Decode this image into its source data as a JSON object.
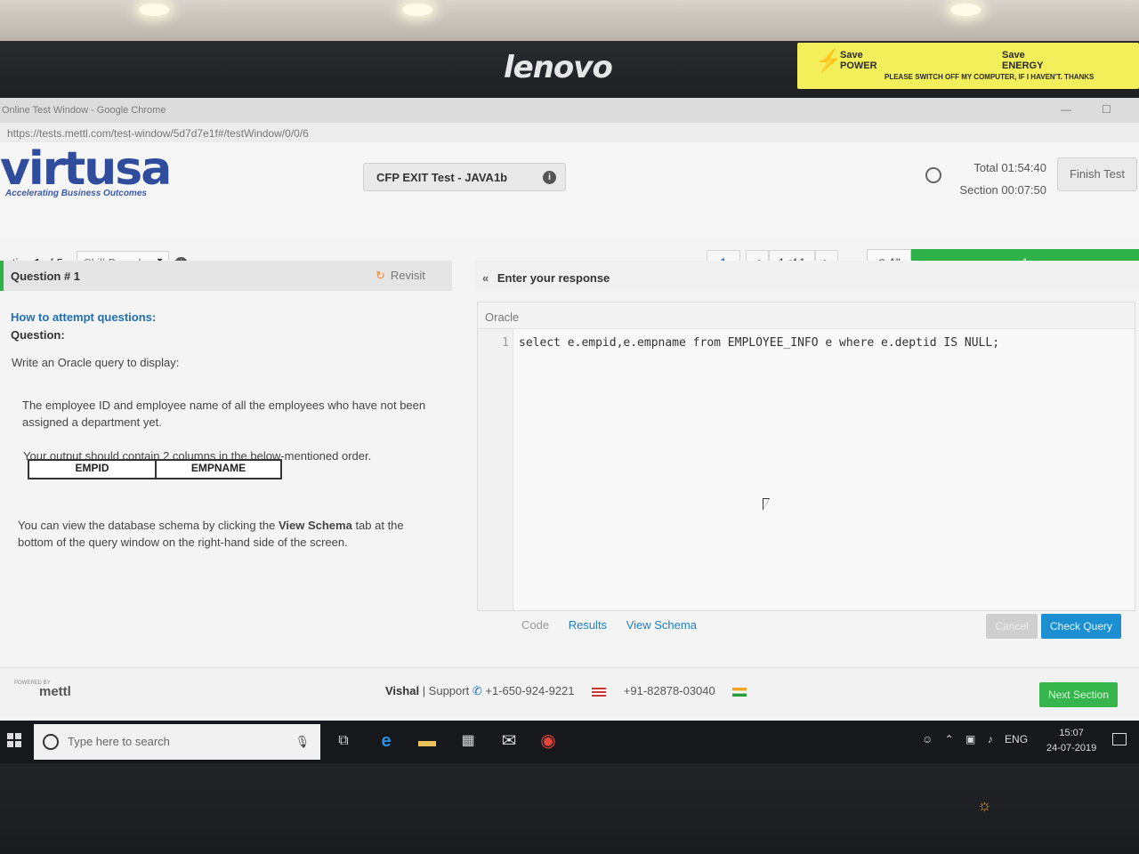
{
  "monitor": {
    "brand": "lenovo",
    "sticker": {
      "line1a": "Save",
      "line1b": "POWER",
      "line2a": "Save",
      "line2b": "ENERGY",
      "note": "PLEASE SWITCH OFF MY COMPUTER, IF I HAVEN'T. THANKS"
    }
  },
  "browser": {
    "title": "Online Test Window - Google Chrome",
    "url": "https://tests.mettl.com/test-window/5d7d7e1f#/testWindow/0/0/6"
  },
  "header": {
    "logo": "virtusa",
    "tagline": "Accelerating Business Outcomes",
    "test_title": "CFP EXIT Test - JAVA1b",
    "total_timer": "Total 01:54:40",
    "section_timer": "Section 00:07:50",
    "finish_label": "Finish Test"
  },
  "nav": {
    "section_prefix": "ection",
    "section_num": "1",
    "section_of": "of 5",
    "section_select": "Skill Based -",
    "page_current": "1",
    "prev": "<",
    "page_info": "1 of 1",
    "next": ">",
    "all_label": "All",
    "progress_label": "1",
    "progress_fraction": 1.0
  },
  "question": {
    "title": "Question # 1",
    "revisit": "Revisit",
    "howto": "How to attempt questions:",
    "label": "Question:",
    "intro": "Write an Oracle query to display:",
    "body": "The employee ID and employee name of all the employees who have not been assigned a department yet.",
    "output_note": "Your output should contain 2 columns in the below-mentioned order.",
    "columns": [
      "EMPID",
      "EMPNAME"
    ],
    "schema_note_a": "You can view the database schema by clicking the",
    "schema_note_bold": "View Schema",
    "schema_note_b": "tab at the bottom of the query window on the right-hand side of the screen."
  },
  "response": {
    "heading": "Enter your response",
    "language": "Oracle",
    "line_number": "1",
    "code": "select e.empid,e.empname from EMPLOYEE_INFO e where e.deptid IS NULL;",
    "tabs": [
      "Code",
      "Results",
      "View Schema"
    ],
    "cancel_label": "Cancel",
    "check_label": "Check Query"
  },
  "footer": {
    "powered_by": "POWERED BY",
    "mettl": "mettl",
    "user": "Vishal",
    "support": "| Support",
    "phone_us": "+1-650-924-9221",
    "phone_in": "+91-82878-03040",
    "next_section": "Next Section"
  },
  "taskbar": {
    "search_placeholder": "Type here to search",
    "language": "ENG",
    "time": "15:07",
    "date": "24-07-2019"
  }
}
